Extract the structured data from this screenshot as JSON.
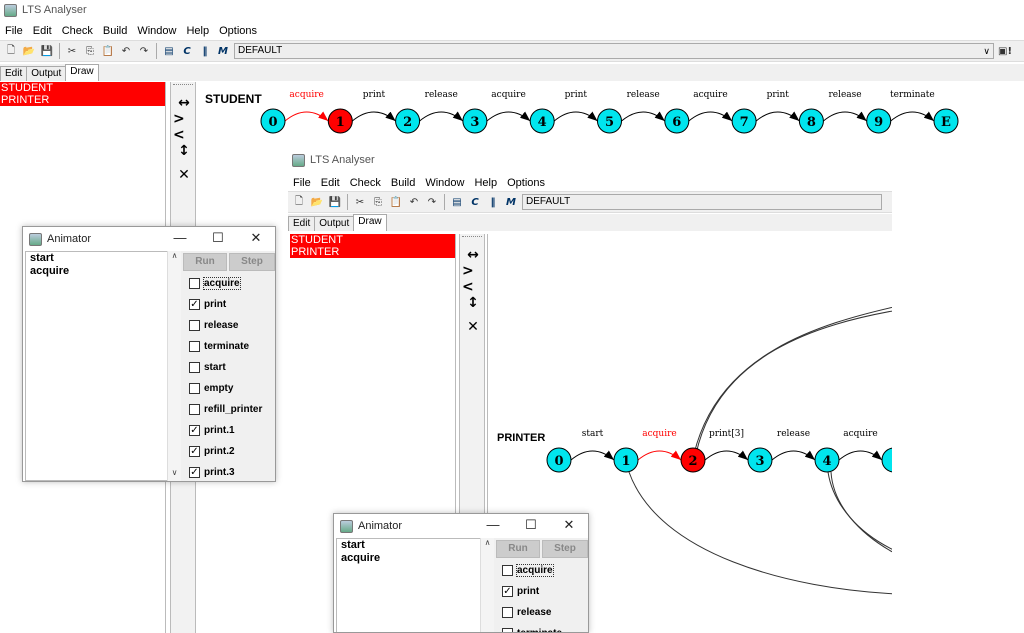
{
  "main": {
    "title": "LTS Analyser",
    "menu": [
      "File",
      "Edit",
      "Check",
      "Build",
      "Window",
      "Help",
      "Options"
    ],
    "target": "DEFAULT",
    "tabs": [
      "Edit",
      "Output",
      "Draw"
    ],
    "processes": [
      "STUDENT",
      "PRINTER"
    ],
    "student_label": "STUDENT",
    "student_states": [
      "0",
      "1",
      "2",
      "3",
      "4",
      "5",
      "6",
      "7",
      "8",
      "9",
      "E"
    ],
    "student_current": "1",
    "student_actions": [
      "acquire",
      "print",
      "release",
      "acquire",
      "print",
      "release",
      "acquire",
      "print",
      "release",
      "terminate"
    ]
  },
  "second": {
    "title": "LTS Analyser",
    "menu": [
      "File",
      "Edit",
      "Check",
      "Build",
      "Window",
      "Help",
      "Options"
    ],
    "target": "DEFAULT",
    "tabs": [
      "Edit",
      "Output",
      "Draw"
    ],
    "processes": [
      "STUDENT",
      "PRINTER"
    ],
    "printer_label": "PRINTER",
    "printer_states": [
      "0",
      "1",
      "2",
      "3",
      "4"
    ],
    "printer_current": "2",
    "printer_actions": [
      "start",
      "acquire",
      "print[3]",
      "release",
      "acquire"
    ]
  },
  "animator1": {
    "title": "Animator",
    "trace": [
      "start",
      "acquire"
    ],
    "run": "Run",
    "step": "Step",
    "actions": [
      {
        "label": "acquire",
        "checked": false
      },
      {
        "label": "print",
        "checked": true
      },
      {
        "label": "release",
        "checked": false
      },
      {
        "label": "terminate",
        "checked": false
      },
      {
        "label": "start",
        "checked": false
      },
      {
        "label": "empty",
        "checked": false
      },
      {
        "label": "refill_printer",
        "checked": false
      },
      {
        "label": "print.1",
        "checked": true
      },
      {
        "label": "print.2",
        "checked": true
      },
      {
        "label": "print.3",
        "checked": true
      }
    ]
  },
  "animator2": {
    "title": "Animator",
    "trace": [
      "start",
      "acquire"
    ],
    "run": "Run",
    "step": "Step",
    "actions": [
      {
        "label": "acquire",
        "checked": false
      },
      {
        "label": "print",
        "checked": true
      },
      {
        "label": "release",
        "checked": false
      },
      {
        "label": "terminate",
        "checked": false
      }
    ]
  },
  "colors": {
    "state": "#00e5ee",
    "current": "#ff0000",
    "selected": "#ff0000",
    "active_action": "#ff0000"
  },
  "icons": [
    "new-icon",
    "open-icon",
    "save-icon",
    "cut-icon",
    "copy-icon",
    "paste-icon",
    "undo-icon",
    "redo-icon",
    "alphabet-icon",
    "compile-icon",
    "parallel-icon",
    "minimise-icon"
  ]
}
